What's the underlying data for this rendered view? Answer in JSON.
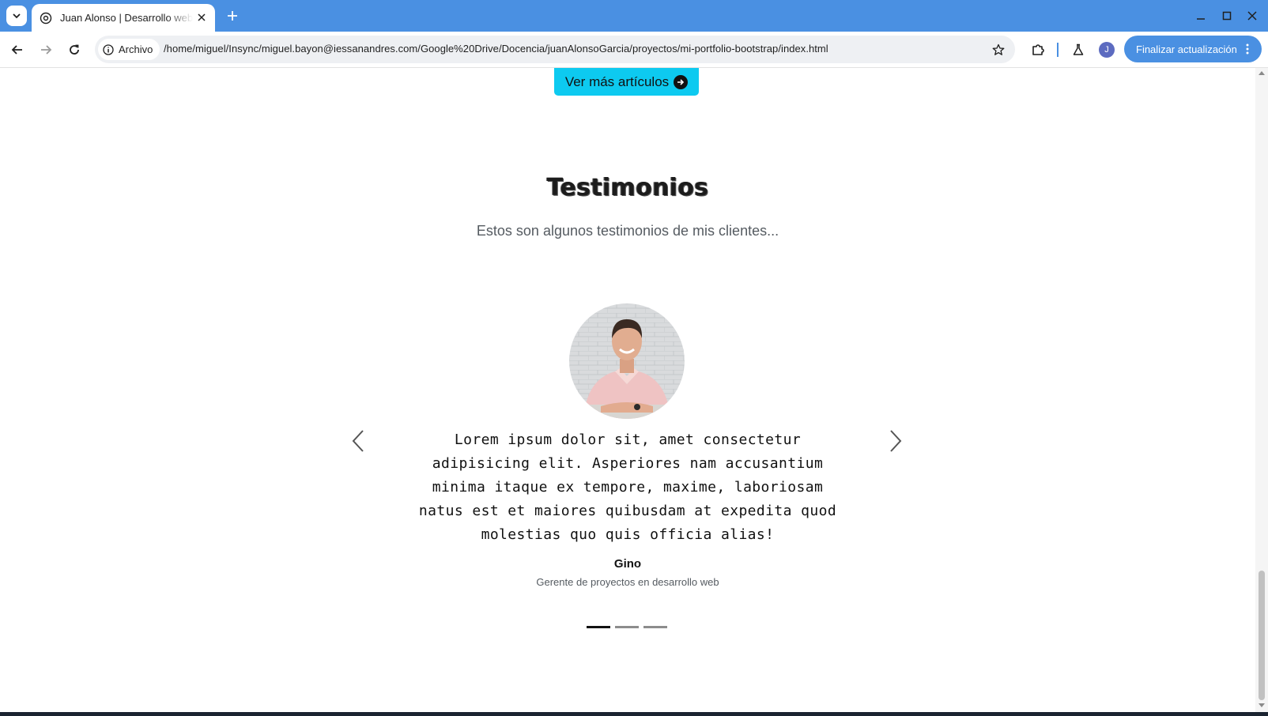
{
  "browser": {
    "tab_title": "Juan Alonso | Desarrollo web",
    "security_chip": "Archivo",
    "url": "/home/miguel/Insync/miguel.bayon@iessanandres.com/Google%20Drive/Docencia/juanAlonsoGarcia/proyectos/mi-portfolio-bootstrap/index.html",
    "profile_initial": "J",
    "update_label": "Finalizar actualización"
  },
  "page": {
    "more_articles_label": "Ver más artículos",
    "testimonials": {
      "title": "Testimonios",
      "subtitle": "Estos son algunos testimonios de mis clientes...",
      "active_index": 0,
      "slide_count": 3,
      "quote": "Lorem ipsum dolor sit, amet consectetur adipisicing elit. Asperiores nam accusantium minima itaque ex tempore, maxime, laboriosam natus est et maiores quibusdam at expedita quod molestias quo quis officia alias!",
      "name": "Gino",
      "role": "Gerente de proyectos en desarrollo web"
    }
  },
  "colors": {
    "chrome_accent": "#4a90e2",
    "button_cyan": "#0dcaf0"
  }
}
